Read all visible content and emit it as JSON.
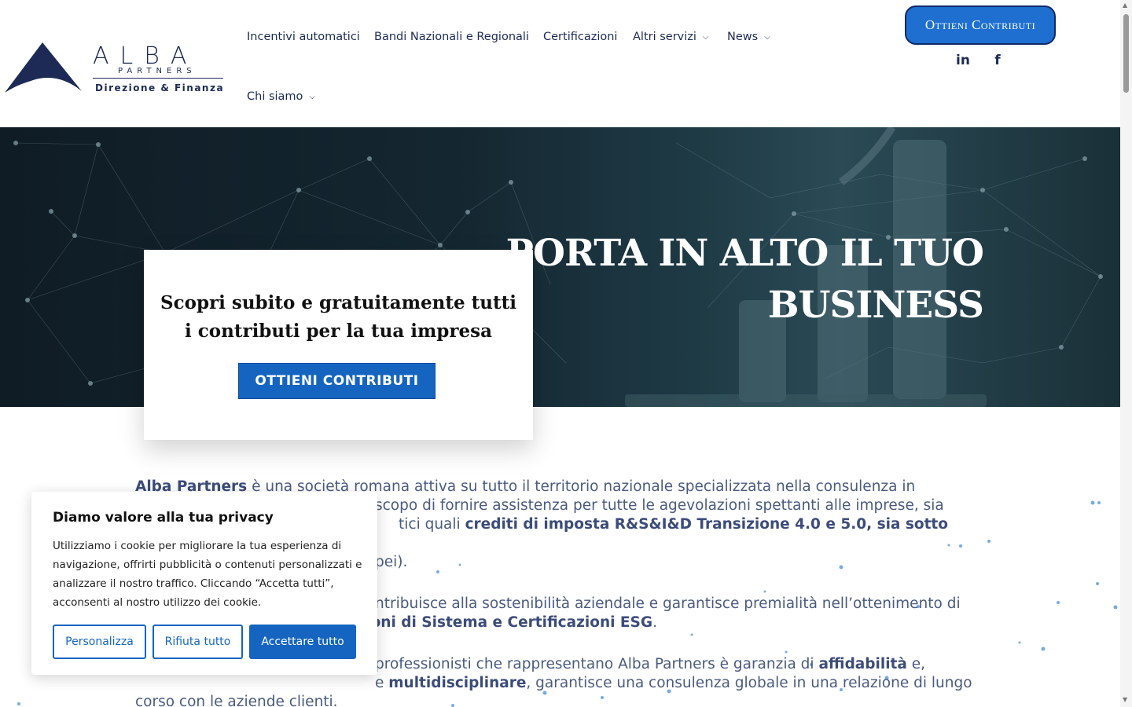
{
  "logo": {
    "word": "ALBA",
    "sub": "PARTNERS",
    "tagline": "Direzione & Finanza"
  },
  "nav": {
    "items": [
      {
        "label": "Incentivi automatici",
        "has_submenu": false
      },
      {
        "label": "Bandi Nazionali e Regionali",
        "has_submenu": false
      },
      {
        "label": "Certificazioni",
        "has_submenu": false
      },
      {
        "label": "Altri servizi",
        "has_submenu": true
      },
      {
        "label": "News",
        "has_submenu": true
      },
      {
        "label": "Chi siamo",
        "has_submenu": true
      }
    ]
  },
  "header": {
    "cta_label": "Ottieni Contributi",
    "social": [
      {
        "icon": "linkedin-icon",
        "glyph": "in"
      },
      {
        "icon": "facebook-icon",
        "glyph": "f"
      }
    ]
  },
  "hero": {
    "title_line1": "PORTA IN ALTO IL TUO",
    "title_line2": "BUSINESS"
  },
  "promo": {
    "text": "Scopri subito e gratuitamente tutti i contributi per la tua impresa",
    "button_label": "OTTIENI CONTRIBUTI"
  },
  "content": {
    "p1_bold": "Alba Partners",
    "p1_a": " è una società romana attiva su tutto il territorio nazionale specializzata nella consulenza in",
    "p1_b": "scopo di fornire assistenza per tutte le agevolazioni spettanti alle imprese, sia",
    "p1_c": "tici quali ",
    "p1_c_bold": "crediti di imposta R&S&I&D Transizione 4.0 e 5.0, sia sotto forma di",
    "p1_d": "pei).",
    "p2_a": "ntribuisce alla sostenibilità aziendale e garantisce premialità nell’ottenimento di",
    "p2_b_bold": "azioni di Sistema e Certificazioni ESG",
    "p2_b_end": ".",
    "p3_a": "professionisti che rappresentano Alba Partners è garanzia di ",
    "p3_a_bold": "affidabilità",
    "p3_a_end": " e,",
    "p3_b": "e ",
    "p3_b_bold": "multidisciplinare",
    "p3_b_end": ", garantisce una consulenza globale in una relazione di lungo",
    "p3_c": "corso con le aziende clienti."
  },
  "cookie": {
    "title": "Diamo valore alla tua privacy",
    "text": "Utilizziamo i cookie per migliorare la tua esperienza di navigazione, offrirti pubblicità o contenuti personalizzati e analizzare il nostro traffico. Cliccando “Accetta tutti”, acconsenti al nostro utilizzo dei cookie.",
    "btn_customize": "Personalizza",
    "btn_reject": "Rifiuta tutto",
    "btn_accept": "Accettare tutto"
  },
  "colors": {
    "brand_navy": "#1c2a55",
    "accent_blue": "#1565c0",
    "text_slate": "#4a5a80"
  }
}
